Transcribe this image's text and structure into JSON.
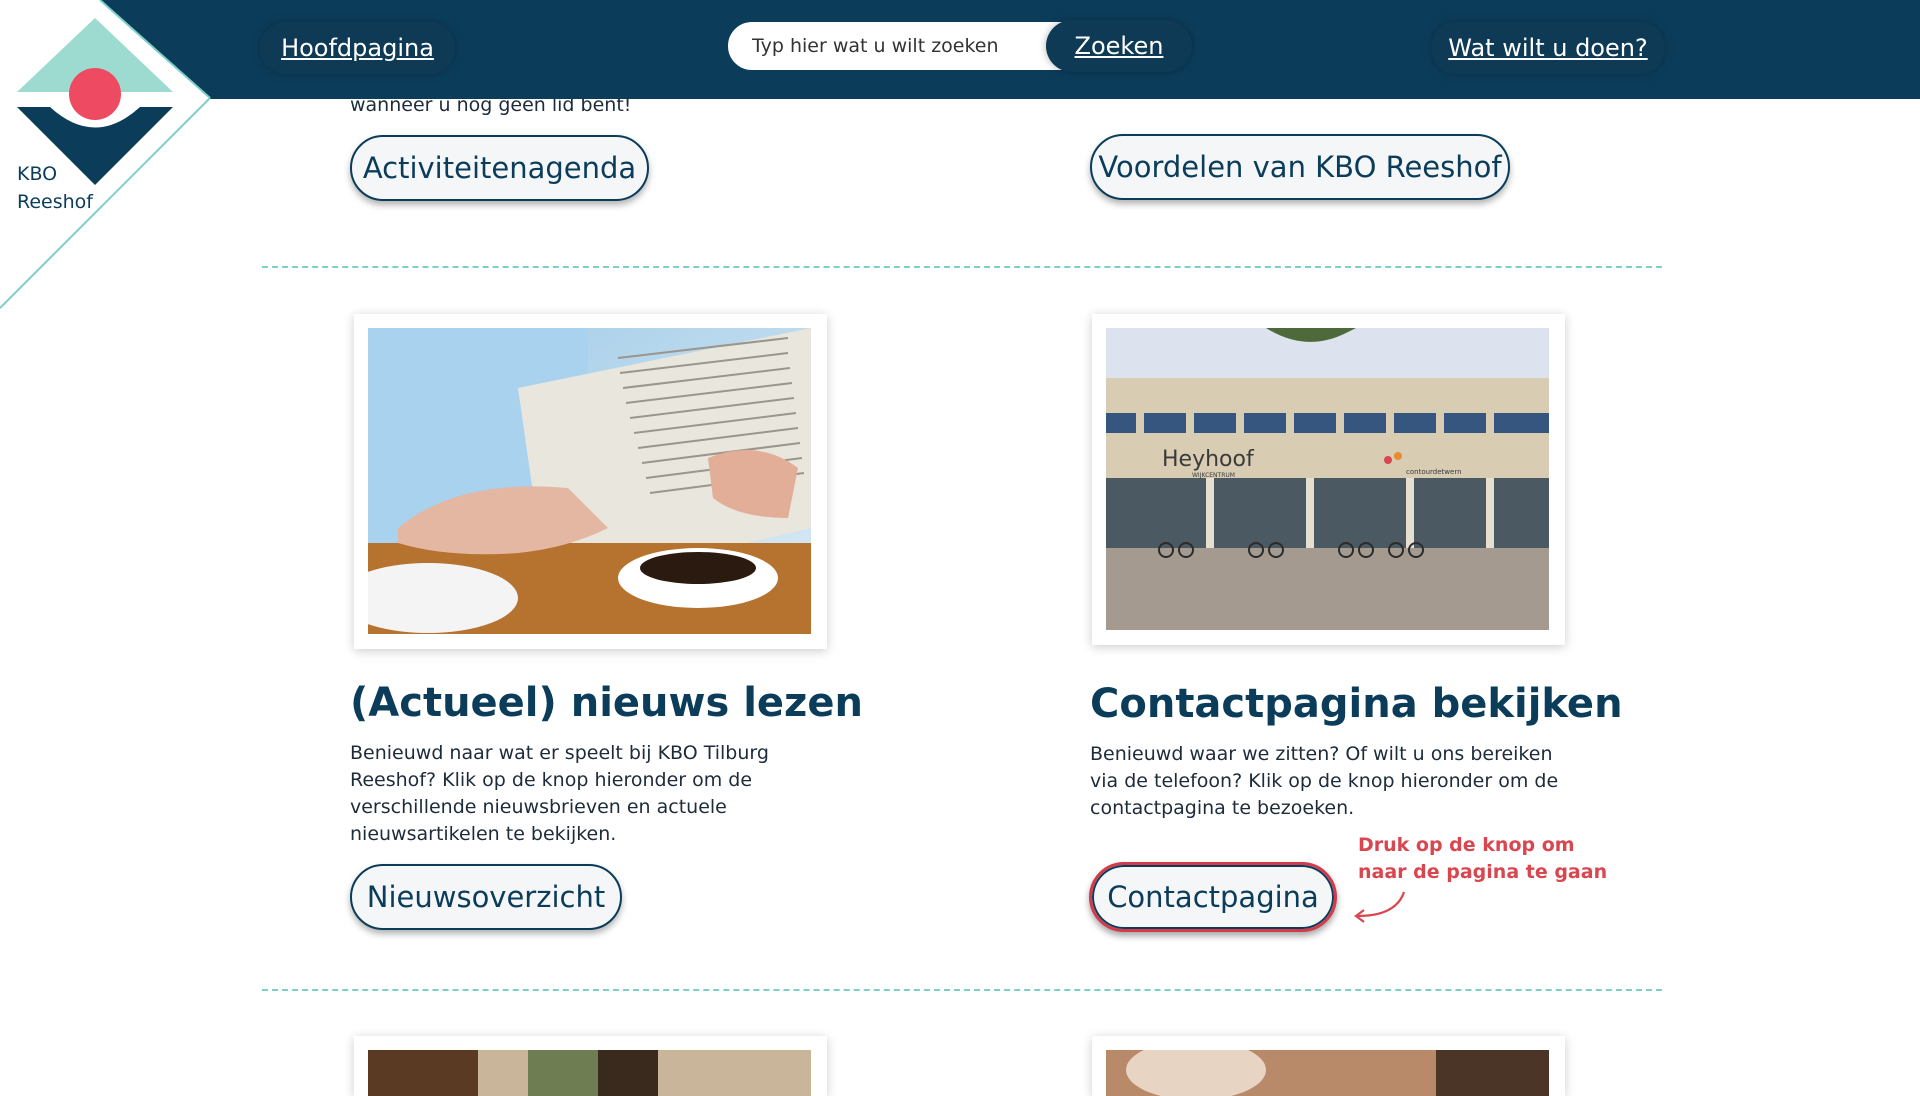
{
  "header": {
    "home_label": "Hoofdpagina",
    "search_placeholder": "Typ hier wat u wilt zoeken",
    "search_button": "Zoeken",
    "todo_label": "Wat wilt u doen?"
  },
  "logo": {
    "line1": "KBO",
    "line2": "Reeshof"
  },
  "intro": {
    "trailing_text": "wanneer u nog geen lid bent!",
    "left_button": "Activiteitenagenda",
    "right_button": "Voordelen van KBO Reeshof"
  },
  "cards": [
    {
      "title": "(Actueel) nieuws lezen",
      "text": "Benieuwd naar wat er speelt bij KBO Tilburg Reeshof? Klik op de knop hieronder om de verschillende nieuwsbrieven en actuele nieuwsartikelen te bekijken.",
      "button": "Nieuwsoverzicht"
    },
    {
      "title": "Contactpagina bekijken",
      "text": "Benieuwd waar we zitten? Of wilt u ons bereiken via de telefoon? Klik op de knop hieronder om de contactpagina te bezoeken.",
      "button": "Contactpagina",
      "photo_sign": "Heyhoof",
      "photo_sign_sub": "WIJKCENTRUM",
      "photo_sign_brand": "contourdetwern"
    }
  ],
  "hint": "Druk op de knop om naar de pagina te gaan",
  "colors": {
    "header": "#0b3d5b",
    "accent_red": "#d9464f",
    "logo_teal": "#9ddbd0",
    "logo_pink": "#ee4a62",
    "divider": "#7ccfc9"
  }
}
